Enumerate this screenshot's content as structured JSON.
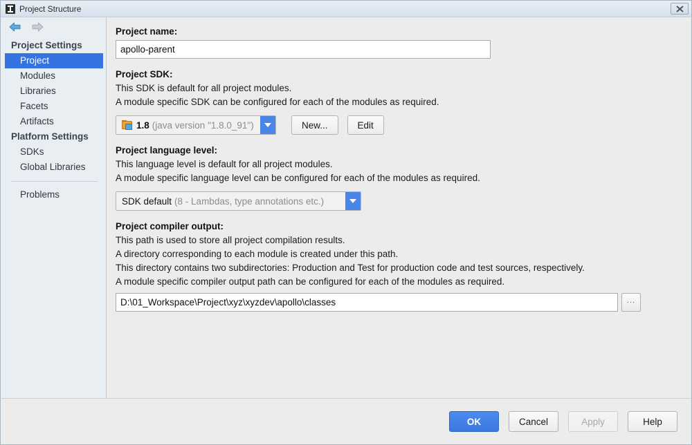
{
  "window": {
    "title": "Project Structure",
    "app_icon": "intellij-idea-icon",
    "close_label": "✕"
  },
  "nav": {
    "back_icon": "arrow-left-icon",
    "forward_icon": "arrow-right-icon"
  },
  "sidebar": {
    "groups": [
      {
        "label": "Project Settings",
        "items": [
          {
            "label": "Project",
            "selected": true
          },
          {
            "label": "Modules",
            "selected": false
          },
          {
            "label": "Libraries",
            "selected": false
          },
          {
            "label": "Facets",
            "selected": false
          },
          {
            "label": "Artifacts",
            "selected": false
          }
        ]
      },
      {
        "label": "Platform Settings",
        "items": [
          {
            "label": "SDKs",
            "selected": false
          },
          {
            "label": "Global Libraries",
            "selected": false
          }
        ]
      }
    ],
    "problems_label": "Problems"
  },
  "main": {
    "project_name": {
      "label": "Project name:",
      "value": "apollo-parent"
    },
    "project_sdk": {
      "label": "Project SDK:",
      "desc1": "This SDK is default for all project modules.",
      "desc2": "A module specific SDK can be configured for each of the modules as required.",
      "selected_name": "1.8",
      "selected_detail": "(java version \"1.8.0_91\")",
      "icon": "jdk-folder-icon",
      "new_button": "New...",
      "edit_button": "Edit"
    },
    "language_level": {
      "label": "Project language level:",
      "desc1": "This language level is default for all project modules.",
      "desc2": "A module specific language level can be configured for each of the modules as required.",
      "selected_name": "SDK default",
      "selected_detail": "(8 - Lambdas, type annotations etc.)"
    },
    "compiler_output": {
      "label": "Project compiler output:",
      "desc1": "This path is used to store all project compilation results.",
      "desc2": "A directory corresponding to each module is created under this path.",
      "desc3": "This directory contains two subdirectories: Production and Test for production code and test sources, respectively.",
      "desc4": "A module specific compiler output path can be configured for each of the modules as required.",
      "value": "D:\\01_Workspace\\Project\\xyz\\xyzdev\\apollo\\classes",
      "browse_label": "..."
    }
  },
  "footer": {
    "ok": "OK",
    "cancel": "Cancel",
    "apply": "Apply",
    "help": "Help"
  },
  "colors": {
    "accent": "#3574e0",
    "combo_arrow": "#4a86e8",
    "sidebar_bg": "#e9eef3",
    "content_bg": "#ececec"
  }
}
